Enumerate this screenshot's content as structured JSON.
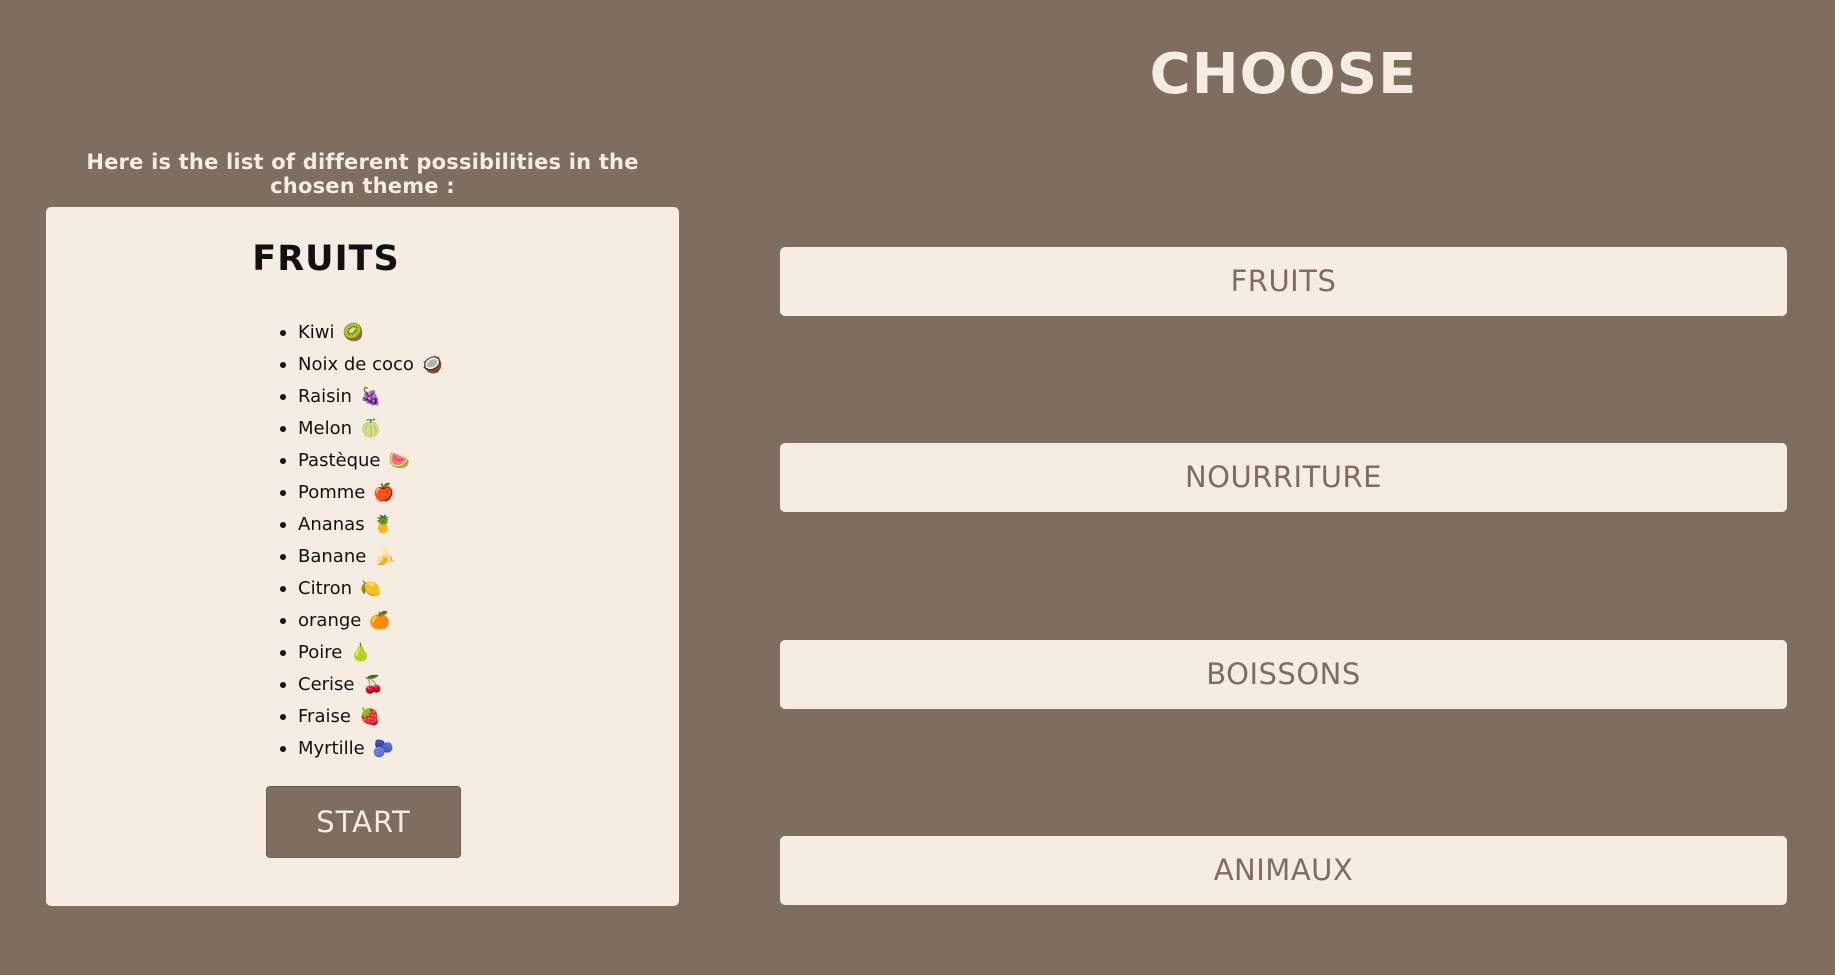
{
  "intro_text": "Here is the list of different possibilities in the chosen theme :",
  "selected_theme": {
    "title": "FRUITS",
    "items": [
      {
        "label": "Kiwi",
        "emoji": "🥝"
      },
      {
        "label": "Noix de coco",
        "emoji": "🥥"
      },
      {
        "label": "Raisin",
        "emoji": "🍇"
      },
      {
        "label": "Melon",
        "emoji": "🍈"
      },
      {
        "label": "Pastèque",
        "emoji": "🍉"
      },
      {
        "label": "Pomme",
        "emoji": "🍎"
      },
      {
        "label": "Ananas",
        "emoji": "🍍"
      },
      {
        "label": "Banane",
        "emoji": "🍌"
      },
      {
        "label": "Citron",
        "emoji": "🍋"
      },
      {
        "label": "orange",
        "emoji": "🍊"
      },
      {
        "label": "Poire",
        "emoji": "🍐"
      },
      {
        "label": "Cerise",
        "emoji": "🍒"
      },
      {
        "label": "Fraise",
        "emoji": "🍓"
      },
      {
        "label": "Myrtille",
        "emoji": "🫐"
      }
    ],
    "start_label": "START"
  },
  "choose_title": "CHOOSE",
  "themes": [
    {
      "label": "FRUITS"
    },
    {
      "label": "NOURRITURE"
    },
    {
      "label": "BOISSONS"
    },
    {
      "label": "ANIMAUX"
    }
  ],
  "colors": {
    "background": "#7f6d5f",
    "card": "#f5ece2",
    "text_dark": "#111111"
  }
}
